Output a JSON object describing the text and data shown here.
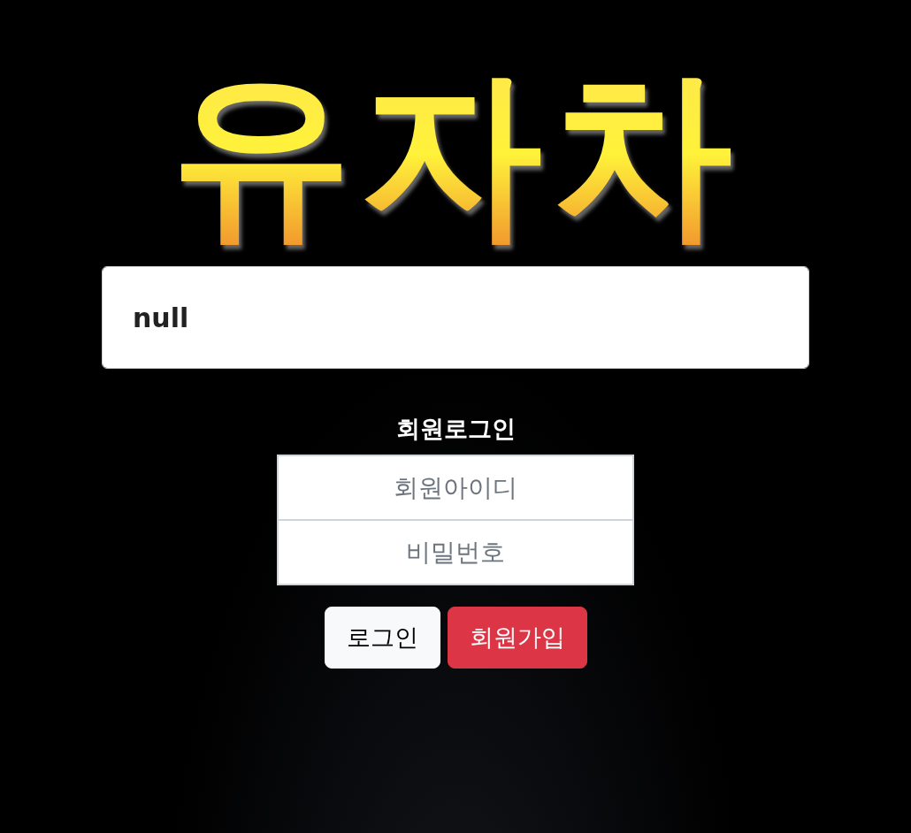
{
  "logo": {
    "text": "유자차"
  },
  "message": {
    "value": "null"
  },
  "login": {
    "title": "회원로그인",
    "fields": [
      {
        "placeholder": "회원아이디"
      },
      {
        "placeholder": "비밀번호"
      }
    ],
    "buttons": [
      {
        "label": "로그인",
        "kind": "light"
      },
      {
        "label": "회원가입",
        "kind": "danger"
      }
    ]
  }
}
